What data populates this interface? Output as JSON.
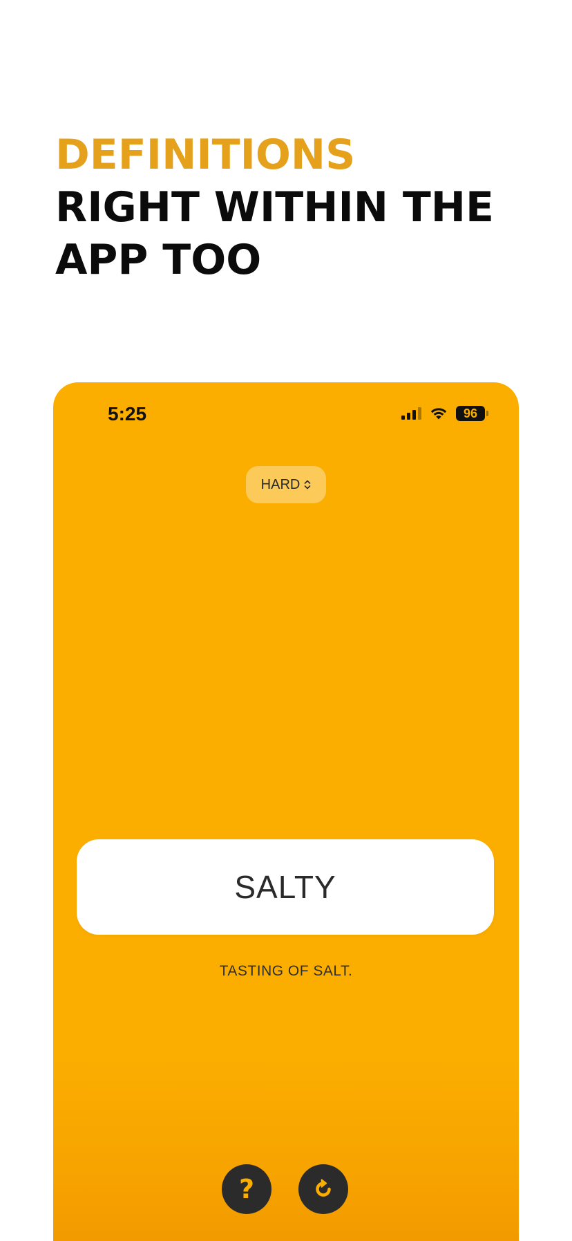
{
  "headline": {
    "accent_line": "DEFINITIONS",
    "line2": "RIGHT WITHIN THE",
    "line3": "APP TOO"
  },
  "status_bar": {
    "time": "5:25",
    "battery": "96",
    "icons": [
      "cellular-signal-icon",
      "wifi-icon",
      "battery-icon"
    ]
  },
  "difficulty": {
    "label": "HARD",
    "icon": "chevron-up-down-icon"
  },
  "card": {
    "word": "SALTY",
    "definition": "TASTING OF SALT."
  },
  "buttons": {
    "help": {
      "glyph": "?",
      "icon": "question-icon"
    },
    "refresh": {
      "icon": "refresh-icon"
    }
  },
  "colors": {
    "accent": "#e5a11c",
    "app_background": "#fbae00",
    "button_dark": "#2b2b2b",
    "text_dark": "#0b0b0b"
  }
}
